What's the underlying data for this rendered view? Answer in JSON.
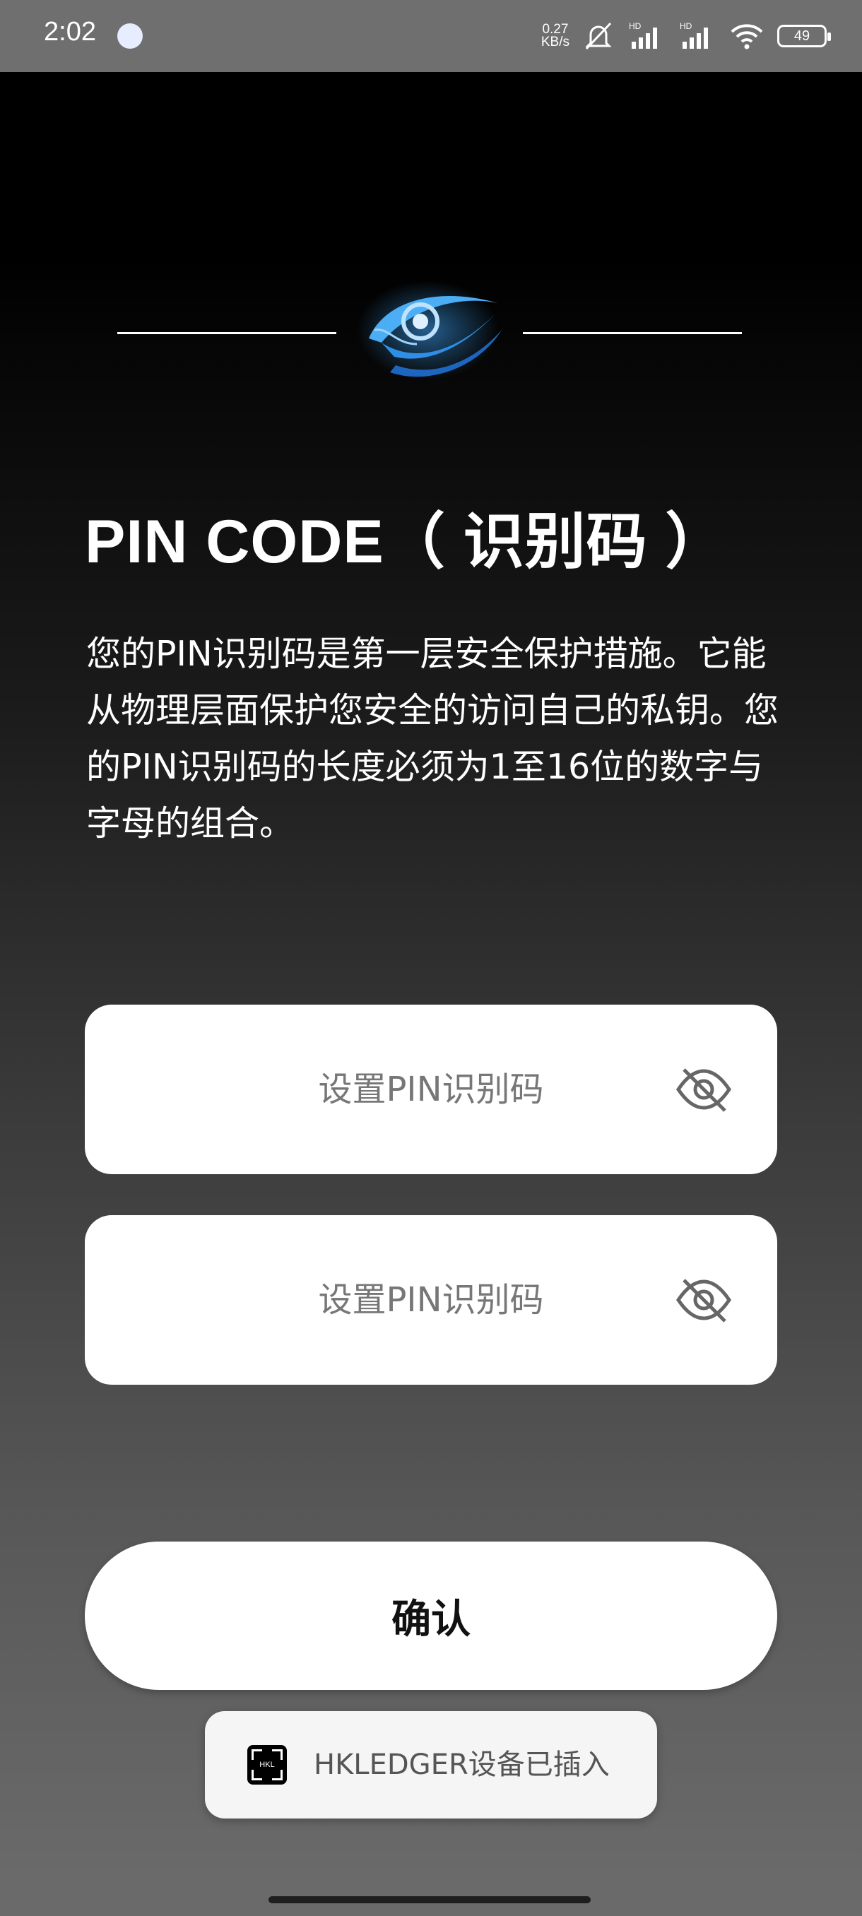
{
  "status_bar": {
    "time": "2:02",
    "speed_value": "0.27",
    "speed_unit": "KB/s",
    "hd1": "HD",
    "hd2": "HD",
    "battery": "49",
    "icons": [
      "app-notification-icon",
      "mute-icon",
      "signal-icon",
      "signal-icon",
      "wifi-icon",
      "battery-icon"
    ]
  },
  "header": {
    "logo_icon": "eye-logo-icon",
    "title": "PIN CODE（ 识别码 ）"
  },
  "description": "您的PIN识别码是第一层安全保护措施。它能从物理层面保护您安全的访问自己的私钥。您的PIN识别码的长度必须为1至16位的数字与字母的组合。",
  "form": {
    "pin_placeholder": "设置PIN识别码",
    "pin_confirm_placeholder": "设置PIN识别码",
    "toggle_icon": "eye-off-icon"
  },
  "confirm_label": "确认",
  "toast": {
    "icon_text": "HKL",
    "text": "HKLEDGER设备已插入"
  },
  "colors": {
    "background_top": "#000000",
    "background_bottom": "#6a6a6a",
    "logo_blue": "#3fa8ff"
  }
}
